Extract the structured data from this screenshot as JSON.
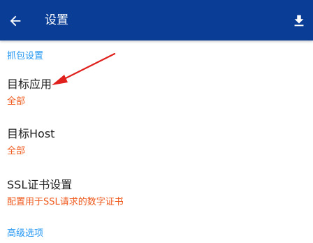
{
  "appbar": {
    "title": "设置",
    "back_icon": "arrow-left-icon",
    "download_icon": "download-icon",
    "background_color": "#0a3d96"
  },
  "sections": [
    {
      "header": "抓包设置",
      "items": [
        {
          "title": "目标应用",
          "summary": "全部"
        },
        {
          "title": "目标Host",
          "summary": "全部"
        },
        {
          "title": "SSL证书设置",
          "summary": "配置用于SSL请求的数字证书"
        }
      ]
    },
    {
      "header": "高级选项",
      "items": []
    }
  ],
  "colors": {
    "section_header": "#2196f3",
    "summary": "#ef5a1f",
    "annotation_arrow": "#e0201c"
  }
}
